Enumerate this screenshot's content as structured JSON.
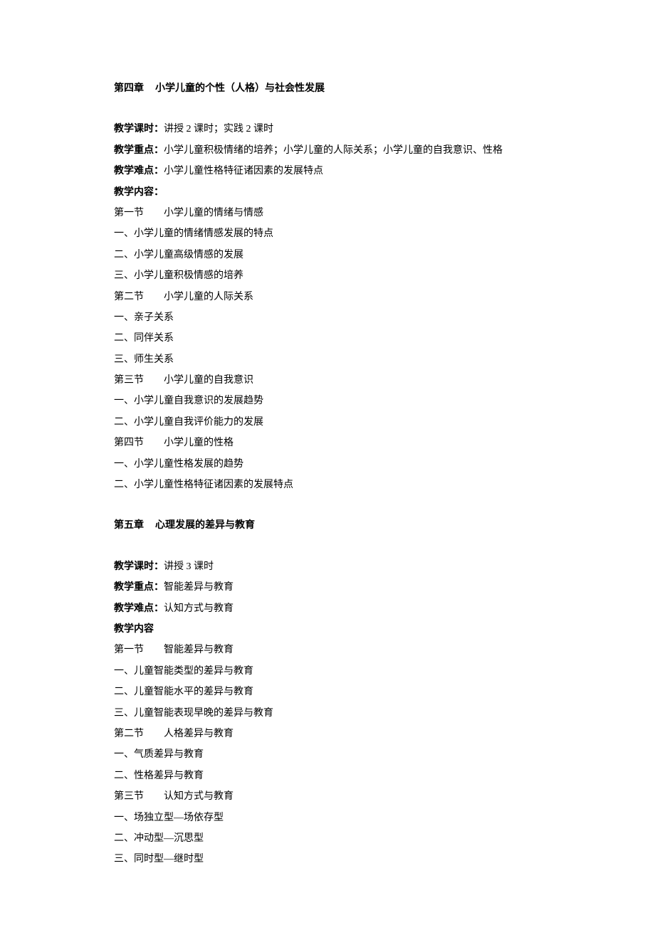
{
  "chapter4": {
    "title_prefix": "第四章",
    "title": "小学儿童的个性（人格）与社会性发展",
    "hours_label": "教学课时：",
    "hours_value": "讲授 2 课时；实践 2 课时",
    "focus_label": "教学重点：",
    "focus_value": "小学儿童积极情绪的培养；小学儿童的人际关系；小学儿童的自我意识、性格",
    "difficulty_label": "教学难点：",
    "difficulty_value": "小学儿童性格特征诸因素的发展特点",
    "content_label": "教学内容：",
    "sections": [
      {
        "prefix": "第一节",
        "title": "小学儿童的情绪与情感",
        "items": [
          "一、小学儿童的情绪情感发展的特点",
          "二、小学儿童高级情感的发展",
          "三、小学儿童积极情感的培养"
        ]
      },
      {
        "prefix": "第二节",
        "title": "小学儿童的人际关系",
        "items": [
          "一、亲子关系",
          "二、同伴关系",
          "三、师生关系"
        ]
      },
      {
        "prefix": "第三节",
        "title": "小学儿童的自我意识",
        "items": [
          "一、小学儿童自我意识的发展趋势",
          "二、小学儿童自我评价能力的发展"
        ]
      },
      {
        "prefix": "第四节",
        "title": "小学儿童的性格",
        "items": [
          "一、小学儿童性格发展的趋势",
          "二、小学儿童性格特征诸因素的发展特点"
        ]
      }
    ]
  },
  "chapter5": {
    "title_prefix": "第五章",
    "title": "心理发展的差异与教育",
    "hours_label": "教学课时：",
    "hours_value": "讲授 3 课时",
    "focus_label": "教学重点：",
    "focus_value": "智能差异与教育",
    "difficulty_label": "教学难点：",
    "difficulty_value": "认知方式与教育",
    "content_label": "教学内容",
    "sections": [
      {
        "prefix": "第一节",
        "title": "智能差异与教育",
        "items": [
          "一、儿童智能类型的差异与教育",
          "二、儿童智能水平的差异与教育",
          "三、儿童智能表现早晚的差异与教育"
        ]
      },
      {
        "prefix": "第二节",
        "title": "人格差异与教育",
        "items": [
          "一、气质差异与教育",
          "二、性格差异与教育"
        ]
      },
      {
        "prefix": "第三节",
        "title": "认知方式与教育",
        "items": [
          "一、场独立型—场依存型",
          "二、冲动型—沉思型",
          "三、同时型—继时型"
        ]
      }
    ]
  }
}
